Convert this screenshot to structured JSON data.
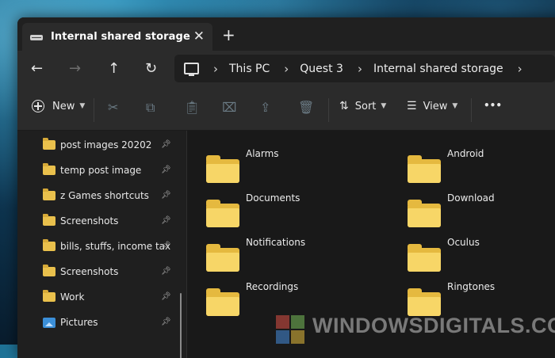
{
  "tab": {
    "title": "Internal shared storage",
    "close": "✕",
    "new_tab": "+"
  },
  "nav": {
    "back": "←",
    "forward": "→",
    "up": "↑",
    "refresh": "↻"
  },
  "breadcrumb": {
    "items": [
      "This PC",
      "Quest 3",
      "Internal shared storage"
    ],
    "separator": "›"
  },
  "commands": {
    "new_label": "New",
    "sort_label": "Sort",
    "view_label": "View",
    "more": "•••"
  },
  "sidebar": {
    "items": [
      {
        "label": "post images 20202",
        "pinned": true
      },
      {
        "label": "temp post image",
        "pinned": true
      },
      {
        "label": "z Games shortcuts",
        "pinned": true
      },
      {
        "label": "Screenshots",
        "pinned": true
      },
      {
        "label": "bills, stuffs, income tax",
        "pinned": true
      },
      {
        "label": "Screenshots",
        "pinned": true
      },
      {
        "label": "Work",
        "pinned": true
      },
      {
        "label": "Pictures",
        "pinned": true
      }
    ]
  },
  "folders": {
    "items": [
      "Alarms",
      "Android",
      "Documents",
      "Download",
      "Notifications",
      "Oculus",
      "Recordings",
      "Ringtones"
    ]
  },
  "watermark": {
    "text": "WINDOWSDIGITALS.COM"
  },
  "colors": {
    "folder_front": "#f7d667",
    "folder_back": "#e5b93f",
    "window_bg": "#1c1c1c",
    "toolbar_bg": "#2b2b2b"
  }
}
